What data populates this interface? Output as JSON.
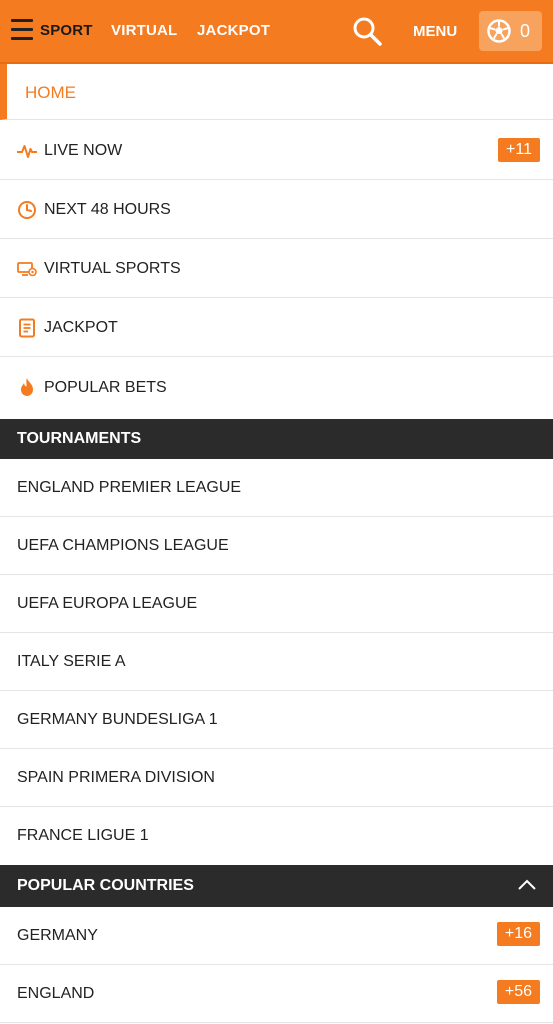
{
  "header": {
    "nav": [
      {
        "label": "SPORT"
      },
      {
        "label": "VIRTUAL"
      },
      {
        "label": "JACKPOT"
      }
    ],
    "menu_label": "MENU",
    "betslip_count": "0",
    "accent_color": "#f47b1f"
  },
  "home": {
    "label": "HOME"
  },
  "menu_items": [
    {
      "label": "LIVE NOW",
      "icon": "pulse-icon",
      "badge": "+11"
    },
    {
      "label": "NEXT 48 HOURS",
      "icon": "clock-icon"
    },
    {
      "label": "VIRTUAL SPORTS",
      "icon": "virtual-sports-icon"
    },
    {
      "label": "JACKPOT",
      "icon": "jackpot-icon"
    },
    {
      "label": "POPULAR BETS",
      "icon": "flame-icon"
    }
  ],
  "tournaments": {
    "title": "TOURNAMENTS",
    "items": [
      "ENGLAND PREMIER LEAGUE",
      "UEFA CHAMPIONS LEAGUE",
      "UEFA EUROPA LEAGUE",
      "ITALY SERIE A",
      "GERMANY BUNDESLIGA 1",
      "SPAIN PRIMERA DIVISION",
      "FRANCE LIGUE 1"
    ]
  },
  "popular_countries": {
    "title": "POPULAR COUNTRIES",
    "items": [
      {
        "label": "GERMANY",
        "badge": "+16"
      },
      {
        "label": "ENGLAND",
        "badge": "+56"
      }
    ]
  }
}
